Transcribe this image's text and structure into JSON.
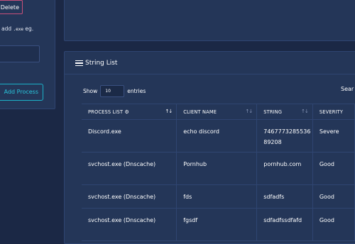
{
  "sidebar": {
    "delete_label": "Delete",
    "hint_prefix": "add",
    "hint_code": ".exe",
    "hint_suffix": "eg.",
    "add_process_label": "Add Process"
  },
  "string_list": {
    "title": "String List",
    "show_label": "Show",
    "entries_value": "10",
    "entries_label": "entries",
    "search_label": "Sear",
    "columns": [
      "PROCESS LIST",
      "CLIENT NAME",
      "STRING",
      "SEVERITY"
    ],
    "rows": [
      {
        "process": "Discord.exe",
        "client": "echo discord",
        "string": "746777328553689208",
        "severity": "Severe"
      },
      {
        "process": "svchost.exe (Dnscache)",
        "client": "Pornhub",
        "string": "pornhub.com",
        "severity": "Good"
      },
      {
        "process": "svchost.exe (Dnscache)",
        "client": "fds",
        "string": "sdfadfs",
        "severity": "Good"
      },
      {
        "process": "svchost.exe (Dnscache)",
        "client": "fgsdf",
        "string": "sdfadfssdfafd",
        "severity": "Good"
      }
    ]
  },
  "icons": {
    "title_icon": "list-lines-icon",
    "process_header_icon": "gear-icon",
    "sort_icon": "sort-arrows-icon"
  },
  "colors": {
    "background": "#1b2845",
    "panel": "#243658",
    "delete_border": "#c9507a",
    "accent": "#29c5db"
  }
}
